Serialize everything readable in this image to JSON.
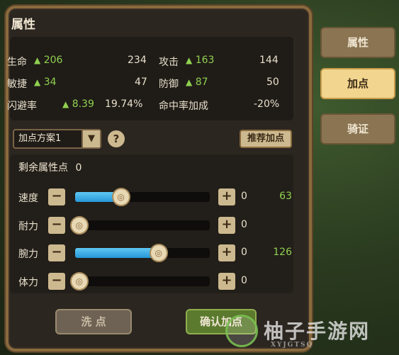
{
  "panel": {
    "title": "属性"
  },
  "stats": [
    {
      "label": "生命",
      "bonus": "206",
      "value": "234"
    },
    {
      "label": "攻击",
      "bonus": "163",
      "value": "144"
    },
    {
      "label": "敏捷",
      "bonus": "34",
      "value": "47"
    },
    {
      "label": "防御",
      "bonus": "87",
      "value": "50"
    },
    {
      "label": "闪避率",
      "bonus": "8.39",
      "value": "19.74%"
    },
    {
      "label": "命中率加成",
      "bonus": "",
      "value": "-20%"
    }
  ],
  "plan": {
    "selected": "加点方案1",
    "help": "?",
    "recommend": "推荐加点"
  },
  "remaining": {
    "label": "剩余属性点",
    "value": "0"
  },
  "attributes": [
    {
      "label": "速度",
      "added": "0",
      "total": "63",
      "fill": 0.34
    },
    {
      "label": "耐力",
      "added": "0",
      "total": "",
      "fill": 0.0
    },
    {
      "label": "腕力",
      "added": "0",
      "total": "126",
      "fill": 0.62
    },
    {
      "label": "体力",
      "added": "0",
      "total": "",
      "fill": 0.0
    }
  ],
  "buttons": {
    "reset": "洗 点",
    "confirm": "确认加点",
    "minus": "−",
    "plus": "+"
  },
  "tabs": [
    {
      "label": "属性",
      "active": false
    },
    {
      "label": "加点",
      "active": true
    },
    {
      "label": "骑证",
      "active": false
    }
  ],
  "watermark": {
    "text": "柚子手游网",
    "sub": "XYJGTSQ"
  },
  "colors": {
    "accent_green": "#8fd14f",
    "slider_blue": "#2696d6",
    "panel_border": "#8a6a3e"
  }
}
